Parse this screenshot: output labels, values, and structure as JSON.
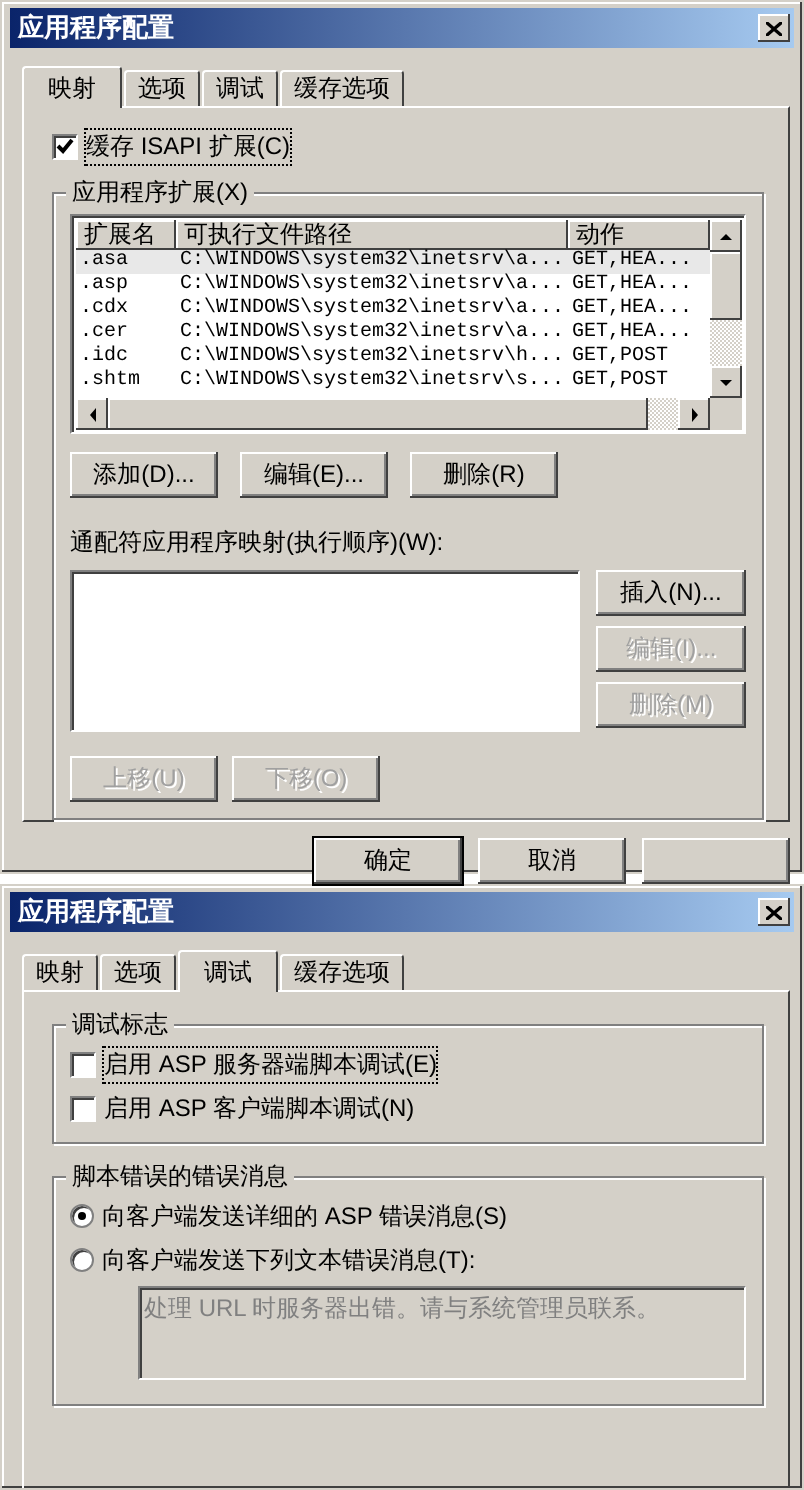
{
  "dialogs": [
    {
      "kind": "mappings",
      "title": "应用程序配置",
      "tabs": [
        {
          "label": "映射",
          "selected": true
        },
        {
          "label": "选项",
          "selected": false
        },
        {
          "label": "调试",
          "selected": false
        },
        {
          "label": "缓存选项",
          "selected": false
        }
      ],
      "cache_checkbox": {
        "label": "缓存 ISAPI 扩展(C)",
        "checked": true
      },
      "group_title": "应用程序扩展(X)",
      "table": {
        "columns": [
          "扩展名",
          "可执行文件路径",
          "动作"
        ],
        "rows": [
          {
            "cells": [
              ".asa",
              "C:\\WINDOWS\\system32\\inetsrv\\a...",
              "GET,HEA..."
            ],
            "selected": true
          },
          {
            "cells": [
              ".asp",
              "C:\\WINDOWS\\system32\\inetsrv\\a...",
              "GET,HEA..."
            ],
            "selected": false
          },
          {
            "cells": [
              ".cdx",
              "C:\\WINDOWS\\system32\\inetsrv\\a...",
              "GET,HEA..."
            ],
            "selected": false
          },
          {
            "cells": [
              ".cer",
              "C:\\WINDOWS\\system32\\inetsrv\\a...",
              "GET,HEA..."
            ],
            "selected": false
          },
          {
            "cells": [
              ".idc",
              "C:\\WINDOWS\\system32\\inetsrv\\h...",
              "GET,POST"
            ],
            "selected": false
          },
          {
            "cells": [
              ".shtm",
              "C:\\WINDOWS\\system32\\inetsrv\\s...",
              "GET,POST"
            ],
            "selected": false
          }
        ]
      },
      "ext_buttons": [
        {
          "label": "添加(D)...",
          "disabled": false
        },
        {
          "label": "编辑(E)...",
          "disabled": false
        },
        {
          "label": "删除(R)",
          "disabled": false
        }
      ],
      "wildcard_label": "通配符应用程序映射(执行顺序)(W):",
      "side_buttons": [
        {
          "label": "插入(N)...",
          "disabled": false
        },
        {
          "label": "编辑(I)...",
          "disabled": true
        },
        {
          "label": "删除(M)",
          "disabled": true
        }
      ],
      "move_buttons": [
        {
          "label": "上移(U)",
          "disabled": true
        },
        {
          "label": "下移(O)",
          "disabled": true
        }
      ],
      "footer_buttons": [
        {
          "label": "确定",
          "default": true
        },
        {
          "label": "取消",
          "default": false
        }
      ]
    },
    {
      "kind": "debug",
      "title": "应用程序配置",
      "tabs": [
        {
          "label": "映射",
          "selected": false
        },
        {
          "label": "选项",
          "selected": false
        },
        {
          "label": "调试",
          "selected": true
        },
        {
          "label": "缓存选项",
          "selected": false
        }
      ],
      "flags_group": {
        "title": "调试标志",
        "checkboxes": [
          {
            "label": "启用 ASP 服务器端脚本调试(E)",
            "checked": false
          },
          {
            "label": "启用 ASP 客户端脚本调试(N)",
            "checked": false
          }
        ]
      },
      "errors_group": {
        "title": "脚本错误的错误消息",
        "radios": [
          {
            "label": "向客户端发送详细的 ASP 错误消息(S)",
            "selected": true
          },
          {
            "label": "向客户端发送下列文本错误消息(T):",
            "selected": false
          }
        ],
        "message": {
          "value": "处理 URL 时服务器出错。请与系统管理员联系。",
          "disabled": true
        }
      }
    }
  ]
}
